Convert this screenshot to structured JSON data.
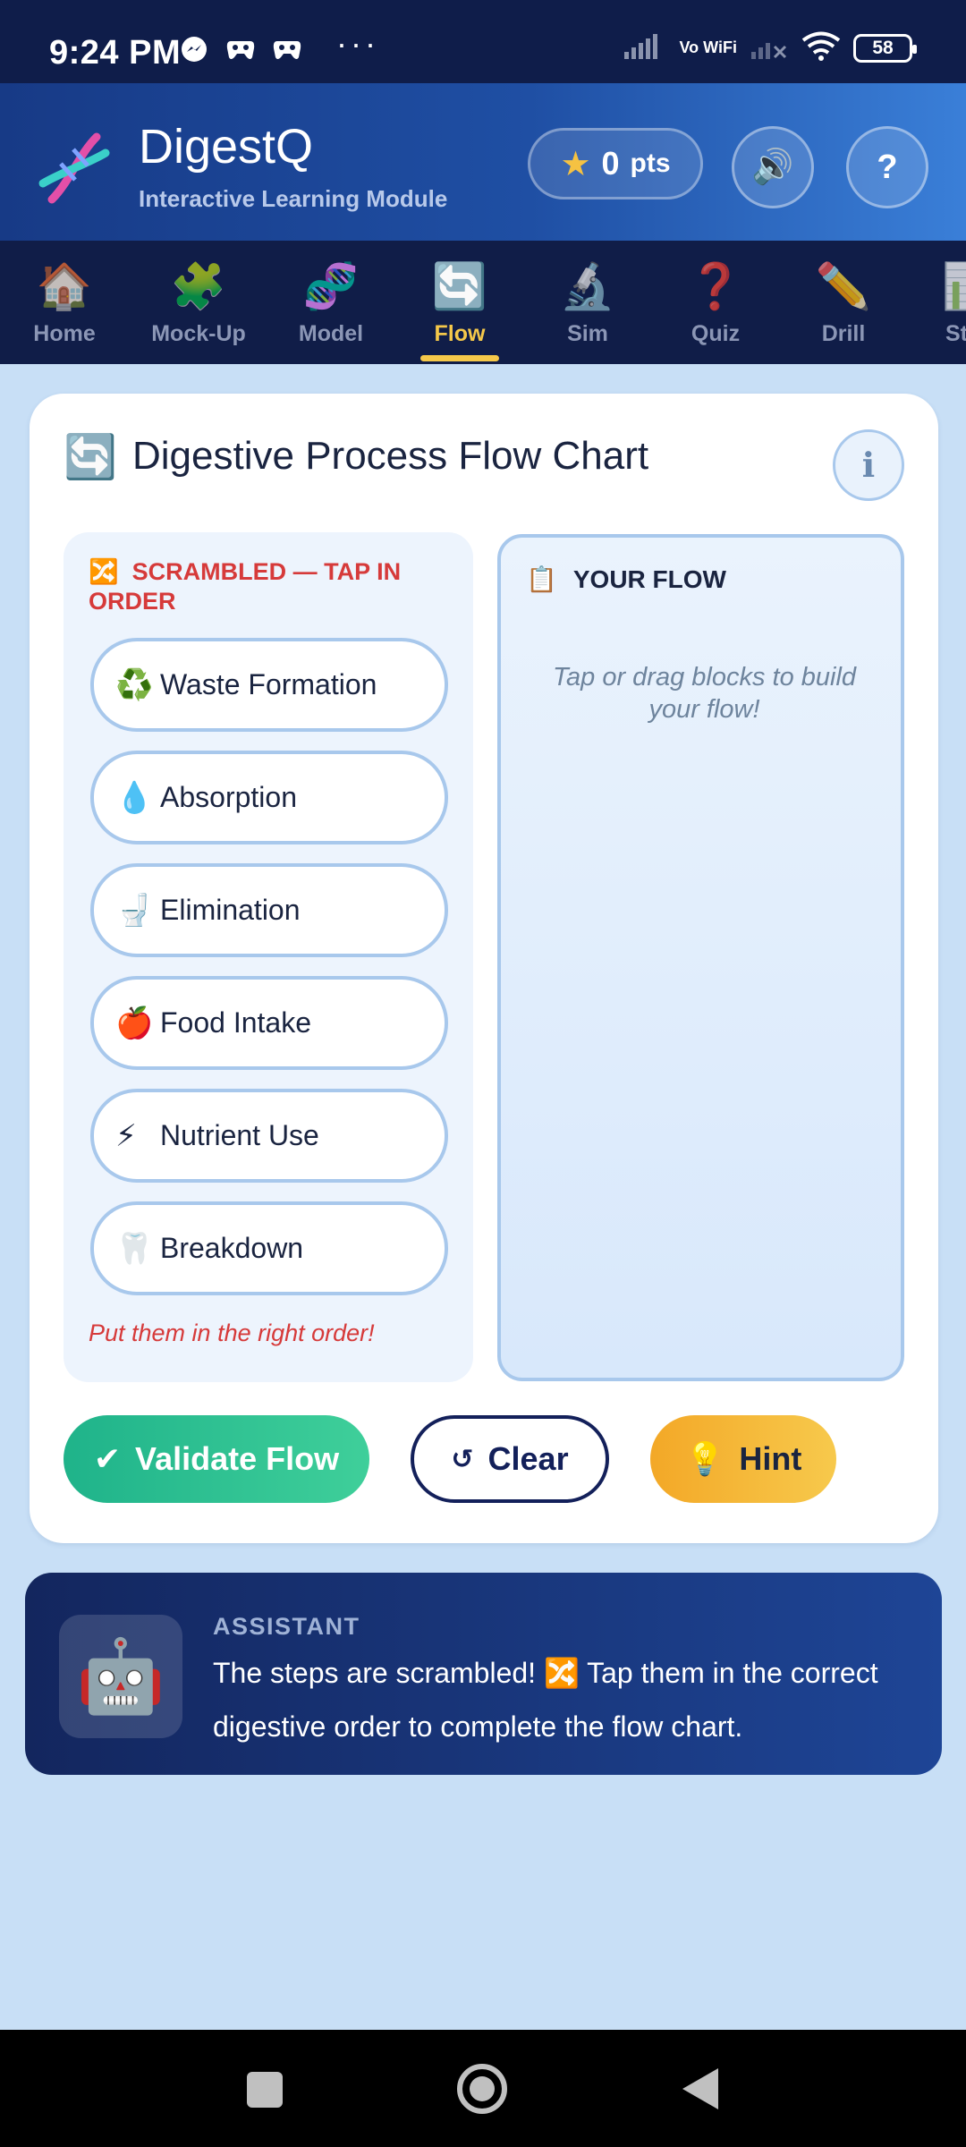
{
  "status_bar": {
    "time": "9:24 PM",
    "left_icons": [
      "messenger-icon",
      "game-controller-icon",
      "game-controller-icon"
    ],
    "more": "···",
    "vowifi": "Vo WiFi",
    "battery": "58"
  },
  "header": {
    "title": "DigestQ",
    "subtitle": "Interactive Learning Module",
    "points_value": "0",
    "points_label": "pts",
    "sound_icon": "🔊",
    "help_label": "?"
  },
  "nav": {
    "items": [
      {
        "label": "Home",
        "icon": "🏠"
      },
      {
        "label": "Mock-Up",
        "icon": "🧩"
      },
      {
        "label": "Model",
        "icon": "🧬"
      },
      {
        "label": "Flow",
        "icon": "🔄"
      },
      {
        "label": "Sim",
        "icon": "🔬"
      },
      {
        "label": "Quiz",
        "icon": "❓"
      },
      {
        "label": "Drill",
        "icon": "✏️"
      },
      {
        "label": "St",
        "icon": "📊"
      }
    ],
    "active_index": 3
  },
  "flow_card": {
    "icon": "🔄",
    "title": "Digestive Process Flow Chart",
    "info_icon": "ℹ",
    "scrambled": {
      "icon": "🔀",
      "header": "SCRAMBLED — TAP IN ORDER",
      "steps": [
        {
          "emoji": "♻️",
          "label": "Waste Formation"
        },
        {
          "emoji": "💧",
          "label": "Absorption"
        },
        {
          "emoji": "🚽",
          "label": "Elimination"
        },
        {
          "emoji": "🍎",
          "label": "Food Intake"
        },
        {
          "emoji": "⚡",
          "label": "Nutrient Use"
        },
        {
          "emoji": "🦷",
          "label": "Breakdown"
        }
      ],
      "footer": "Put them in the right order!"
    },
    "your_flow": {
      "icon": "📋",
      "header": "YOUR FLOW",
      "placeholder": "Tap or drag blocks to build your flow!"
    },
    "buttons": {
      "validate_icon": "✔",
      "validate_label": "Validate Flow",
      "clear_icon": "↺",
      "clear_label": "Clear",
      "hint_icon": "💡",
      "hint_label": "Hint"
    }
  },
  "assistant": {
    "icon": "🤖",
    "label": "ASSISTANT",
    "message": "The steps are scrambled! 🔀 Tap them in the correct digestive order to complete the flow chart."
  },
  "colors": {
    "status_bar": "#0f1d4a",
    "header_gradient_start": "#173a86",
    "header_gradient_end": "#3a7fd8",
    "nav_bg": "#101d48",
    "active_tab": "#f5c84a",
    "scrambled_red": "#d63a3a",
    "validate_green": "#1fb38a",
    "hint_orange": "#f3a827",
    "page_bg": "#c8dff6"
  }
}
